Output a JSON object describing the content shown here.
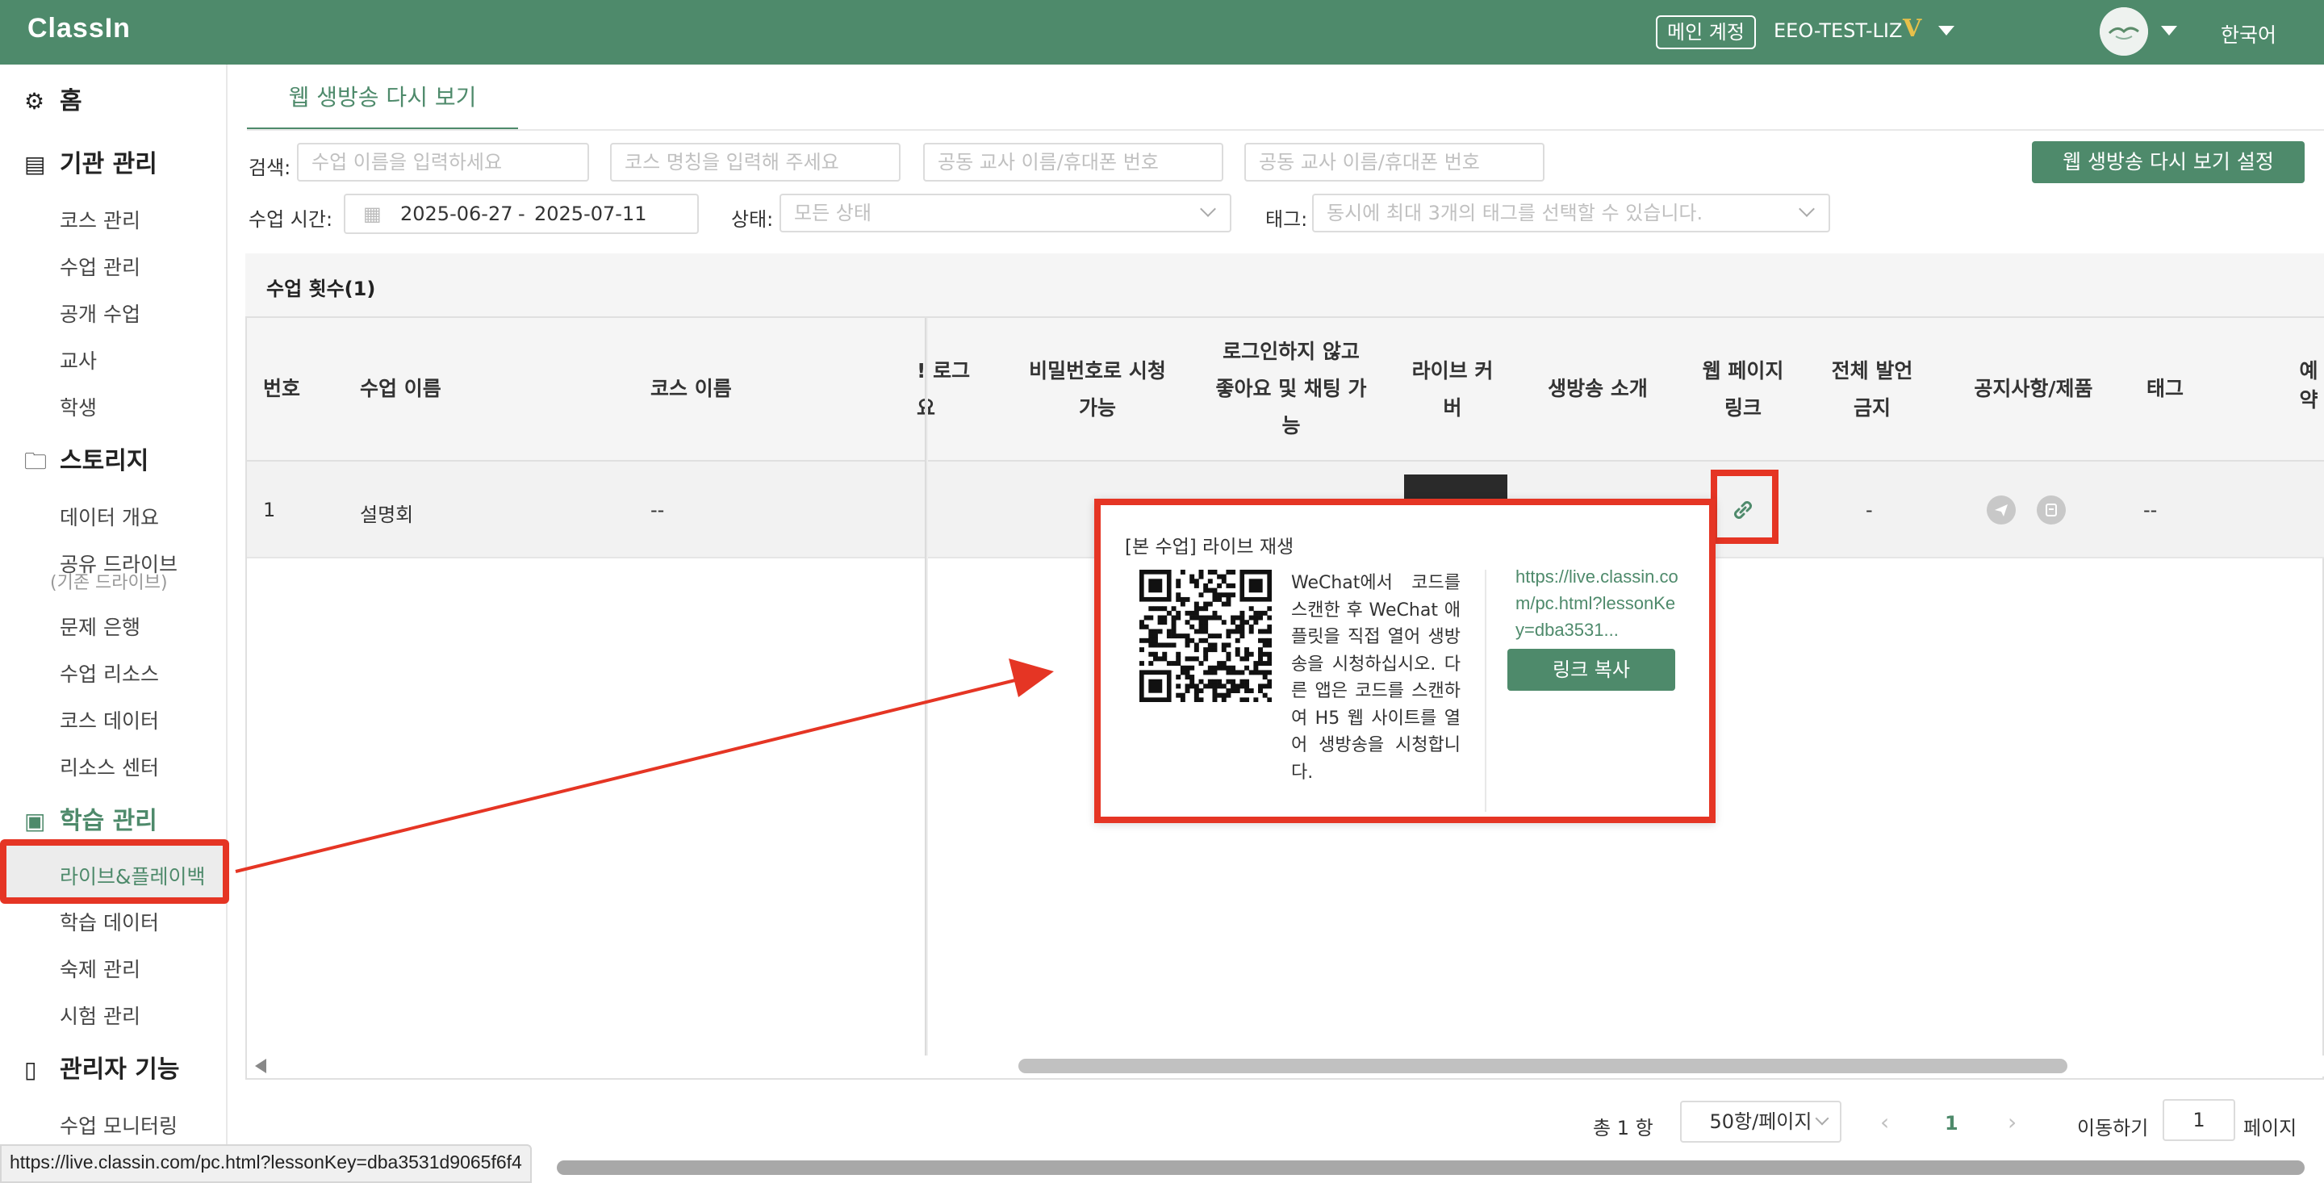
{
  "app": {
    "logo": "ClassIn"
  },
  "header": {
    "main_account": "메인 계정",
    "account_name": "EEO-TEST-LIZ",
    "vip_badge": "V",
    "language": "한국어"
  },
  "sidebar": {
    "home": "홈",
    "org_title": "기관 관리",
    "org_items": [
      "코스 관리",
      "수업 관리",
      "공개 수업",
      "교사",
      "학생"
    ],
    "storage_title": "스토리지",
    "storage_items": [
      "데이터 개요",
      "공유 드라이브",
      "(기존 드라이브)",
      "문제 은행",
      "수업 리소스",
      "코스 데이터",
      "리소스 센터"
    ],
    "learning_title": "학습 관리",
    "learning_items": [
      "라이브&플레이백",
      "학습 데이터",
      "숙제 관리",
      "시험 관리"
    ],
    "admin_title": "관리자 기능",
    "admin_items": [
      "수업 모니터링"
    ]
  },
  "tab": {
    "label": "웹 생방송 다시 보기"
  },
  "filters": {
    "search_label": "검색:",
    "search_lesson_placeholder": "수업 이름을 입력하세요",
    "search_course_placeholder": "코스 명칭을 입력해 주세요",
    "search_coteacher_placeholder_1": "공동 교사 이름/휴대폰 번호",
    "search_coteacher_placeholder_2": "공동 교사 이름/휴대폰 번호",
    "time_label": "수업 시간:",
    "date_start": "2025-06-27",
    "date_sep": "-",
    "date_end": "2025-07-11",
    "status_label": "상태:",
    "status_placeholder": "모든 상태",
    "tag_label": "태그:",
    "tag_placeholder": "동시에 최대 3개의 태그를 선택할 수 있습니다.",
    "settings_button": "웹 생방송 다시 보기 설정"
  },
  "table": {
    "title": "수업 횟수(1)",
    "headers": {
      "no": "번호",
      "lesson": "수업 이름",
      "course": "코스 이름",
      "login_partial_1": "! 로그",
      "login_partial_2": "요",
      "password_1": "비밀번호로 시청",
      "password_2": "가능",
      "nologin_1": "로그인하지 않고",
      "nologin_2": "좋아요 및 채팅 가",
      "nologin_3": "능",
      "cover_1": "라이브 커",
      "cover_2": "버",
      "intro": "생방송 소개",
      "weblink_1": "웹 페이지",
      "weblink_2": "링크",
      "mute_1": "전체 발언",
      "mute_2": "금지",
      "notice": "공지사항/제품",
      "tag": "태그",
      "reserve_partial": "예약"
    },
    "rows": [
      {
        "no": "1",
        "lesson": "설명회",
        "course": "--",
        "mute": "-",
        "tag": "--"
      }
    ]
  },
  "popover": {
    "title": "[본 수업] 라이브 재생",
    "description": "WeChat에서 코드를 스캔한 후 WeChat 애플릿을 직접 열어 생방송을 시청하십시오. 다른 앱은 코드를 스캔하여 H5 웹 사이트를 열어 생방송을 시청합니다.",
    "url": "https://live.classin.com/pc.html?lessonKey=dba3531...",
    "copy_button": "링크 복사"
  },
  "pagination": {
    "total": "총 1 항",
    "page_size": "50항/페이지",
    "current_page": "1",
    "goto_label": "이동하기",
    "goto_value": "1",
    "page_suffix": "페이지"
  },
  "status_bar": {
    "url": "https://live.classin.com/pc.html?lessonKey=dba3531d9065f6f4"
  },
  "colors": {
    "brand": "#4e8a6b",
    "annotation": "#e53524"
  }
}
